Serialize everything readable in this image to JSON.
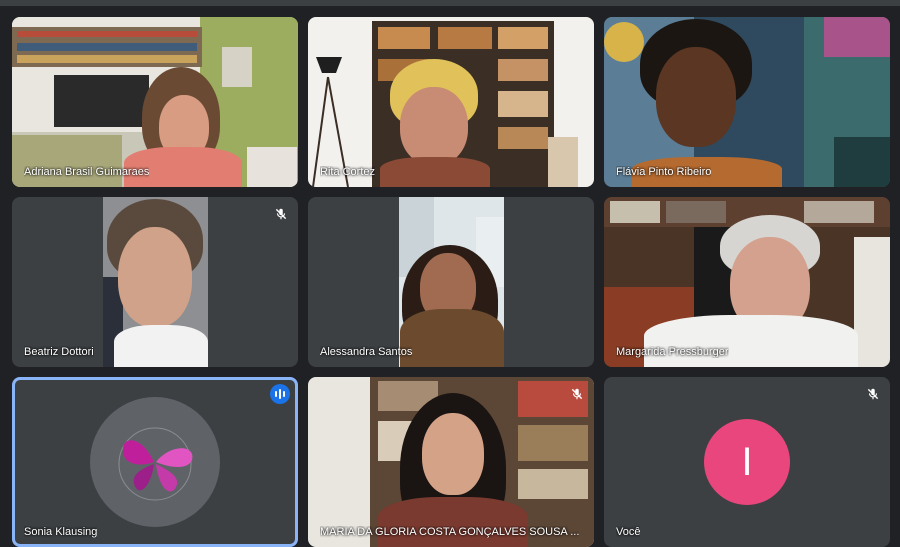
{
  "participants": [
    {
      "name": "Adriana Brasil Guimaraes",
      "muted": false
    },
    {
      "name": "Rita Cortez",
      "muted": false
    },
    {
      "name": "Flávia Pinto Ribeiro",
      "muted": false
    },
    {
      "name": "Beatriz Dottori",
      "muted": true
    },
    {
      "name": "Alessandra Santos",
      "muted": false
    },
    {
      "name": "Margarida Pressburger",
      "muted": false
    },
    {
      "name": "Sonia Klausing",
      "muted": false,
      "speaking": true
    },
    {
      "name": "MARIA DA GLORIA COSTA GONÇALVES SOUSA ...",
      "muted": true
    },
    {
      "name": "Você",
      "muted": true,
      "avatar_letter": "I",
      "avatar_color": "#e8467c"
    }
  ],
  "icons": {
    "muted": "mic-off-icon",
    "speaking": "audio-level-icon",
    "butterfly": "butterfly-logo-icon"
  },
  "colors": {
    "background": "#202124",
    "tile": "#3c4043",
    "speaking_border": "#8ab4f8",
    "avatar_you": "#e8467c"
  }
}
